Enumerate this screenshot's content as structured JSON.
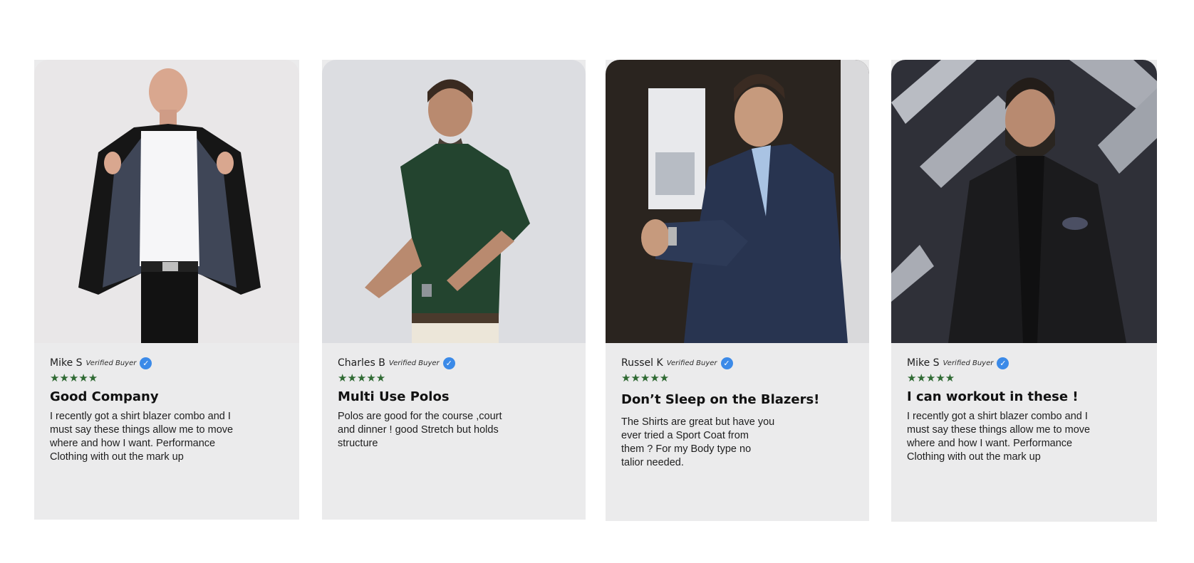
{
  "reviews": [
    {
      "name": "Mike S",
      "verified_label": "Verified Buyer",
      "stars": "★★★★★",
      "title": "Good Company",
      "text_lines": [
        "I recently got a shirt blazer combo  and I",
        "must say these things allow me to move",
        "where and how I want. Performance",
        "Clothing with out the mark up"
      ]
    },
    {
      "name": "Charles B",
      "verified_label": "Verified Buyer",
      "stars": "★★★★★",
      "title": "Multi Use Polos",
      "text_lines": [
        "Polos are good for the course ,court",
        "and dinner ! good Stretch but holds",
        "structure"
      ]
    },
    {
      "name": "Russel K",
      "verified_label": "Verified Buyer",
      "stars": "★★★★★",
      "title": "Don’t Sleep on the Blazers!",
      "text_lines": [
        "The Shirts are great but have you",
        "ever tried a Sport Coat from",
        "them ? For my Body type no",
        "talior needed."
      ]
    },
    {
      "name": "Mike S",
      "verified_label": "Verified Buyer",
      "stars": "★★★★★",
      "title": "I can workout in these !",
      "text_lines": [
        "I recently got a shirt blazer combo  and I",
        "must say these things allow me to move",
        "where and how I want. Performance",
        "Clothing with out the mark up"
      ]
    }
  ],
  "icons": {
    "verified": "verified-check-icon",
    "star": "star-icon"
  },
  "colors": {
    "card_background": "#ebebec",
    "star": "#2f6a33",
    "verified_badge": "#3b8ae8"
  }
}
